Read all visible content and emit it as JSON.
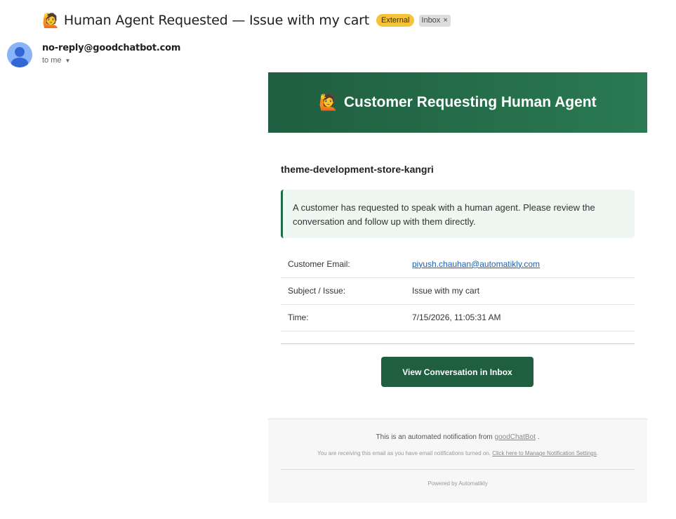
{
  "email": {
    "subject_emoji": "🙋",
    "subject": "Human Agent Requested — Issue with my cart",
    "labels": {
      "external": "External",
      "inbox": "Inbox",
      "remove_label_glyph": "×"
    },
    "sender": "no-reply@goodchatbot.com",
    "recipient": "to me",
    "recipient_caret": "▼"
  },
  "card": {
    "banner_emoji": "🙋",
    "banner_title": "Customer Requesting Human Agent",
    "store_name": "theme-development-store-kangri",
    "notice": "A customer has requested to speak with a human agent. Please review the conversation and follow up with them directly.",
    "details": [
      {
        "label": "Customer Email:",
        "value": "piyush.chauhan@automatikly.com"
      },
      {
        "label": "Subject / Issue:",
        "value": "Issue with my cart"
      },
      {
        "label": "Time:",
        "value": "7/15/2026, 11:05:31 AM"
      }
    ],
    "cta_label": "View Conversation in Inbox"
  },
  "footer": {
    "line1_prefix": "This is an automated notification from",
    "line1_link": "goodChatBot",
    "line1_suffix": ".",
    "line2_prefix": "You are receiving this email as you have email notifications turned on.",
    "line2_link": "Click here to Manage Notification Settings",
    "line2_suffix": ".",
    "powered_by": "Powered by Automatikly"
  },
  "colors": {
    "banner": "#1f5e3f",
    "external_badge": "#f7c235",
    "link": "#1a5fb4",
    "notice_border": "#1f6b47"
  },
  "icons": {
    "avatar": "person-avatar-icon",
    "caret": "caret-down-icon",
    "remove_label": "close-icon"
  }
}
